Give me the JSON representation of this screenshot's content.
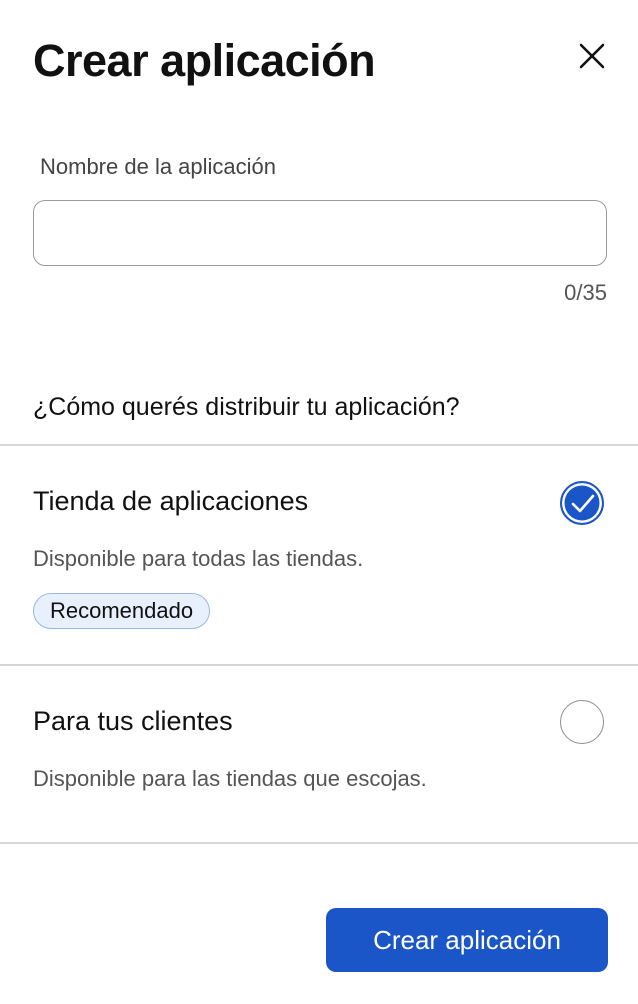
{
  "dialog": {
    "title": "Crear aplicación",
    "close_icon": "close-icon"
  },
  "name_field": {
    "label": "Nombre de la aplicación",
    "value": "",
    "placeholder": "",
    "counter": "0/35"
  },
  "distribution": {
    "question": "¿Cómo querés distribuir tu aplicación?",
    "options": [
      {
        "title": "Tienda de aplicaciones",
        "description": "Disponible para todas las tiendas.",
        "badge": "Recomendado",
        "selected": true
      },
      {
        "title": "Para tus clientes",
        "description": "Disponible para las tiendas que escojas.",
        "selected": false
      }
    ]
  },
  "footer": {
    "submit_label": "Crear aplicación"
  },
  "colors": {
    "primary": "#1a56c7",
    "badge_bg": "#e7f0fc",
    "badge_border": "#98b8e6",
    "divider": "#d6d6d6"
  }
}
